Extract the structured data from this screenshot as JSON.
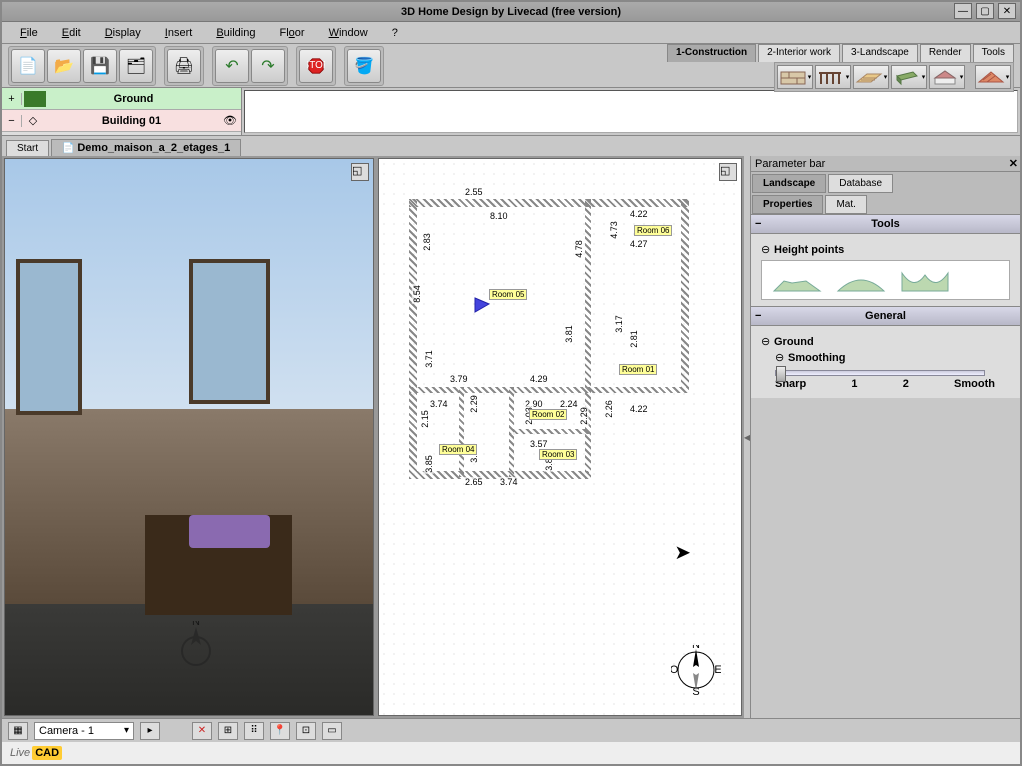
{
  "app": {
    "title": "3D Home Design by Livecad (free version)"
  },
  "menu": {
    "file": "File",
    "edit": "Edit",
    "display": "Display",
    "insert": "Insert",
    "building": "Building",
    "floor": "Floor",
    "window": "Window",
    "help": "?"
  },
  "modeTabs": {
    "construction": "1-Construction",
    "interior": "2-Interior work",
    "landscape": "3-Landscape",
    "render": "Render",
    "tools": "Tools"
  },
  "layers": {
    "ground": "Ground",
    "building": "Building 01"
  },
  "docTabs": {
    "start": "Start",
    "demo": "Demo_maison_a_2_etages_1"
  },
  "plan": {
    "dims": {
      "d1": "2.55",
      "d2": "8.10",
      "d3": "4.22",
      "d4": "4.73",
      "d5": "4.27",
      "d6": "4.78",
      "d7": "8.54",
      "d8": "3.71",
      "d9": "3.79",
      "d10": "4.29",
      "d11": "3.81",
      "d12": "2.83",
      "d13": "3.17",
      "d14": "2.81",
      "d15": "3.74",
      "d16": "2.29",
      "d17": "2.15",
      "d18": "2.90",
      "d19": "2.03",
      "d20": "2.24",
      "d21": "2.29",
      "d22": "2.26",
      "d23": "4.22",
      "d24": "3.85",
      "d25": "2.65",
      "d26": "3.74",
      "d27": "3.57",
      "d28": "3.83",
      "d29": "3.98"
    },
    "rooms": {
      "r1": "Room 01",
      "r2": "Room 02",
      "r3": "Room 03",
      "r4": "Room 04",
      "r5": "Room 05",
      "r6": "Room 06"
    },
    "compass": {
      "n": "N",
      "s": "S",
      "e": "E",
      "o": "O"
    }
  },
  "paramBar": {
    "title": "Parameter bar",
    "tabs": {
      "landscape": "Landscape",
      "database": "Database",
      "properties": "Properties",
      "mat": "Mat."
    },
    "toolsHeader": "Tools",
    "heightPoints": "Height points",
    "generalHeader": "General",
    "ground": "Ground",
    "smoothing": "Smoothing",
    "slider": {
      "sharp": "Sharp",
      "v1": "1",
      "v2": "2",
      "smooth": "Smooth"
    }
  },
  "status": {
    "camera": "Camera - 1"
  },
  "footer": {
    "brand1": "Live",
    "brand2": "CAD"
  }
}
